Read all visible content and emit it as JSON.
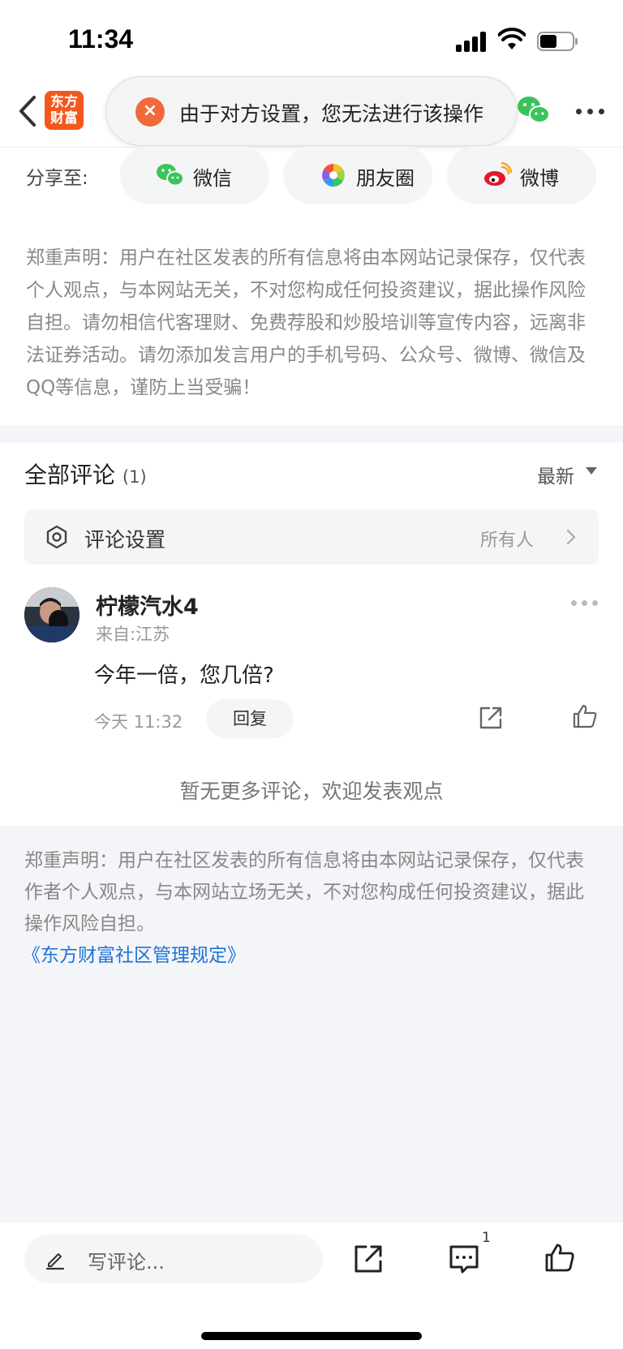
{
  "status_bar": {
    "time": "11:34"
  },
  "nav": {
    "logo_line1": "东方",
    "logo_line2": "财富"
  },
  "toast": {
    "icon": "×",
    "message": "由于对方设置，您无法进行该操作"
  },
  "share": {
    "label": "分享至:",
    "options": [
      {
        "label": "微信",
        "icon": "wechat-icon"
      },
      {
        "label": "朋友圈",
        "icon": "moments-icon"
      },
      {
        "label": "微博",
        "icon": "weibo-icon"
      }
    ]
  },
  "disclaimer_top": "郑重声明：用户在社区发表的所有信息将由本网站记录保存，仅代表个人观点，与本网站无关，不对您构成任何投资建议，据此操作风险自担。请勿相信代客理财、免费荐股和炒股培训等宣传内容，远离非法证券活动。请勿添加发言用户的手机号码、公众号、微博、微信及QQ等信息，谨防上当受骗！",
  "comments": {
    "title": "全部评论",
    "count": "(1)",
    "sort_label": "最新",
    "settings": {
      "label": "评论设置",
      "value": "所有人"
    },
    "items": [
      {
        "username": "柠檬汽水4",
        "location": "来自:江苏",
        "text": "今年一倍，您几倍?",
        "time": "今天 11:32",
        "reply_label": "回复"
      }
    ],
    "no_more": "暂无更多评论，欢迎发表观点"
  },
  "disclaimer_bottom": "郑重声明：用户在社区发表的所有信息将由本网站记录保存，仅代表作者个人观点，与本网站立场无关，不对您构成任何投资建议，据此操作风险自担。",
  "rules_link": "《东方财富社区管理规定》",
  "bottom_bar": {
    "placeholder": "写评论...",
    "comment_count": "1"
  },
  "colors": {
    "brand": "#f2571c",
    "link": "#1e73d8",
    "toast_icon": "#f2693a"
  }
}
